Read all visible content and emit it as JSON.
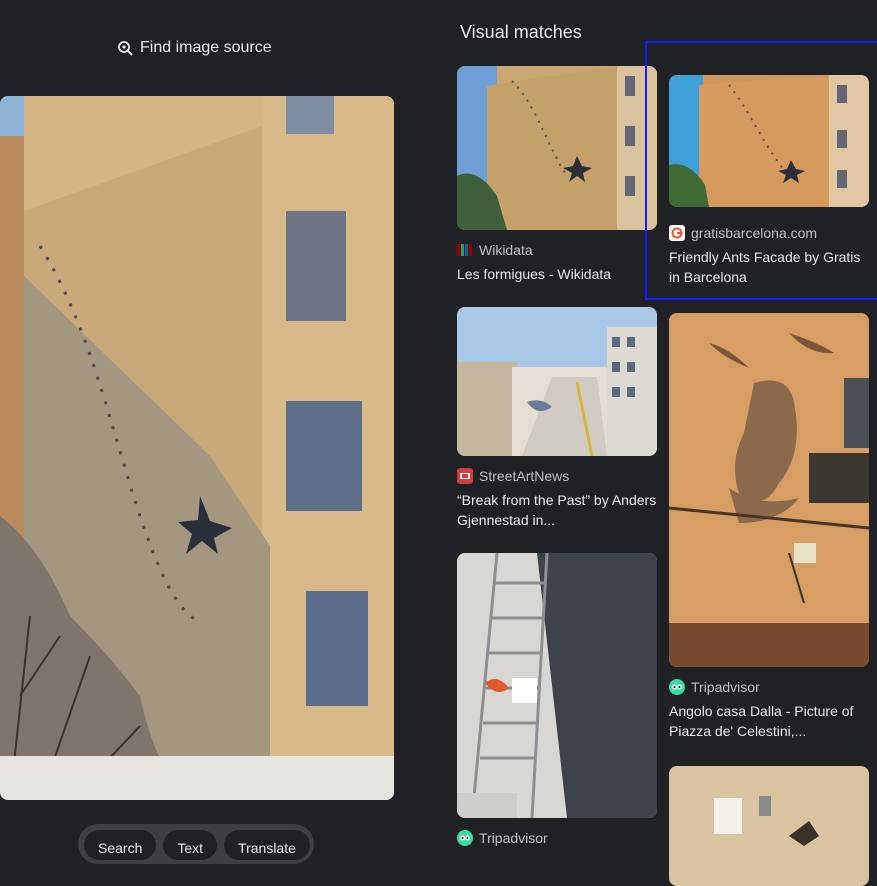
{
  "left_pane": {
    "find_source_label": "Find image source",
    "modes": [
      "Search",
      "Text",
      "Translate"
    ]
  },
  "visual_matches": {
    "title": "Visual matches",
    "results": [
      {
        "source": "Wikidata",
        "title": "Les formigues - Wikidata",
        "favicon": "wikidata-icon"
      },
      {
        "source": "gratisbarcelona.com",
        "title": "Friendly Ants Facade by Gratis in Barcelona",
        "favicon": "gratisbarcelona-icon"
      },
      {
        "source": "StreetArtNews",
        "title": "“Break from the Past” by Anders Gjennestad in...",
        "favicon": "streetartnews-icon"
      },
      {
        "source": "Tripadvisor",
        "title": "Angolo casa Dalla - Picture of Piazza de' Celestini,...",
        "favicon": "tripadvisor-icon"
      },
      {
        "source": "Tripadvisor",
        "title": "",
        "favicon": "tripadvisor-icon"
      }
    ]
  },
  "colors": {
    "background": "#202124",
    "text": "#e8eaed",
    "secondary_text": "#bdc1c6",
    "highlight_border": "#1a1aff"
  }
}
